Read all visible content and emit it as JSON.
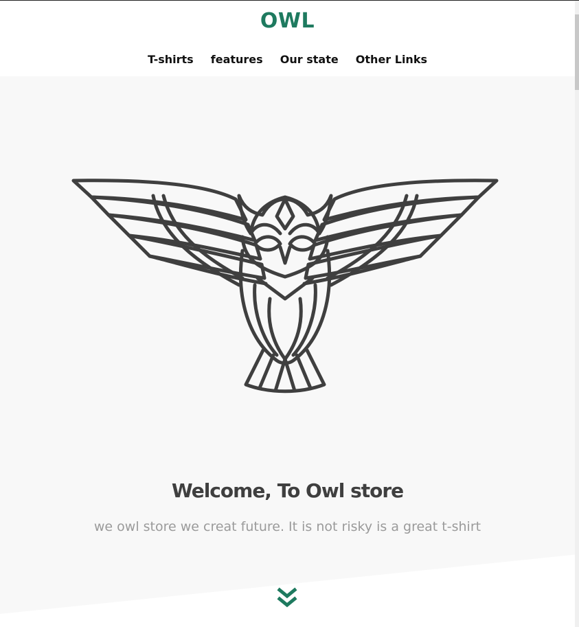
{
  "header": {
    "logo": "OWL",
    "nav": [
      {
        "label": "T-shirts"
      },
      {
        "label": "features"
      },
      {
        "label": "Our state"
      },
      {
        "label": "Other Links"
      }
    ]
  },
  "hero": {
    "image_icon": "owl-icon",
    "title": "Welcome,  To Owl store",
    "subtitle": "we owl store we creat future. It is not risky is a great t-shirt",
    "scroll_icon": "double-chevron-down-icon"
  },
  "colors": {
    "brand": "#1e7a5f",
    "nav_text": "#111111",
    "hero_bg": "#f8f8f8",
    "title": "#3f3f3f",
    "subtitle": "#9a9a9a",
    "owl_stroke": "#3f3f3f"
  }
}
